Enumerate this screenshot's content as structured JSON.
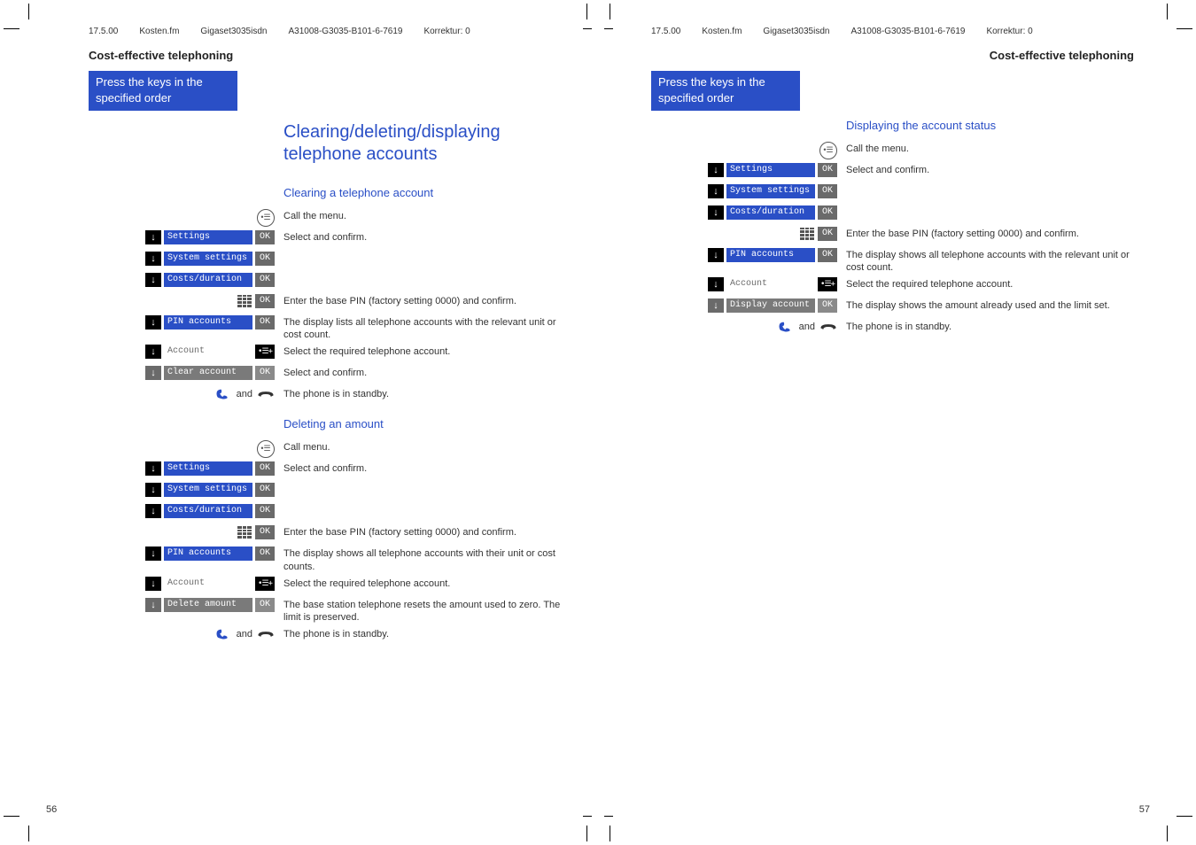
{
  "header": {
    "date": "17.5.00",
    "file": "Kosten.fm",
    "product": "Gigaset3035isdn",
    "docnum": "A31008-G3035-B101-6-7619",
    "korrektur": "Korrektur: 0"
  },
  "section_title": "Cost-effective telephoning",
  "keys_box": "Press the keys in the specified order",
  "labels": {
    "settings": "Settings",
    "system_settings": "System settings",
    "costs_duration": "Costs/duration",
    "pin_accounts": "PIN accounts",
    "account": "Account",
    "clear_account": "Clear account",
    "delete_amount": "Delete amount",
    "display_account": "Display account",
    "ok": "OK",
    "and": "and"
  },
  "left_page": {
    "heading": "Clearing/deleting/displaying telephone accounts",
    "sub1": "Clearing a telephone account",
    "sub2": "Deleting an amount",
    "t_callmenu": "Call the menu.",
    "t_callmenu2": "Call menu.",
    "t_select_confirm": "Select and confirm.",
    "t_enter_pin": "Enter the base PIN (factory setting 0000) and confirm.",
    "t_display_lists": "The display lists all telephone accounts with the relevant unit or cost count.",
    "t_select_required": "Select the required telephone account.",
    "t_standby": "The phone is in standby.",
    "t_display_shows_unit": "The display shows all telephone accounts with their unit or cost counts.",
    "t_base_reset": "The base station telephone resets the amount used to zero. The limit is preserved."
  },
  "right_page": {
    "sub": "Displaying the account status",
    "t_callmenu": "Call the menu.",
    "t_select_confirm": "Select and confirm.",
    "t_enter_pin": "Enter the base PIN (factory setting 0000) and confirm.",
    "t_display_shows": "The display shows all telephone accounts with the relevant unit or cost count.",
    "t_select_required": "Select the required telephone account.",
    "t_amount_used": "The display shows the amount already used and the limit set.",
    "t_standby": "The phone is in standby."
  },
  "page_nums": {
    "left": "56",
    "right": "57"
  }
}
